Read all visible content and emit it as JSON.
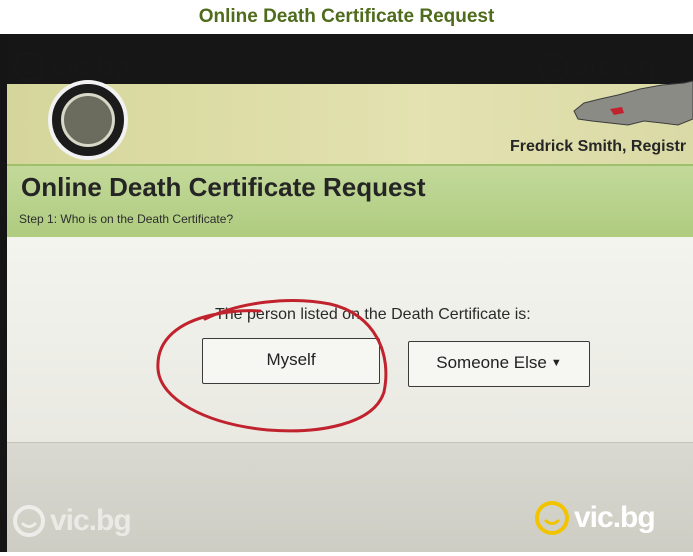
{
  "page_title": "Online Death Certificate Request",
  "photo": {
    "registrar": "Fredrick Smith, Registr",
    "heading": "Online Death Certificate Request",
    "step": "Step 1: Who is on the Death Certificate?",
    "prompt": "The person listed on the Death Certificate is:",
    "options": [
      {
        "label": "Myself",
        "selected": false
      },
      {
        "label": "Someone Else",
        "has_dropdown": true
      }
    ],
    "annotation_color": "#c0232d"
  },
  "watermark": {
    "text": "vic.bg",
    "icon": "smiley-icon"
  },
  "colors": {
    "title": "#4f6b1c",
    "header_green": "#b4cf86",
    "banner_yellow": "#dcdca8"
  }
}
